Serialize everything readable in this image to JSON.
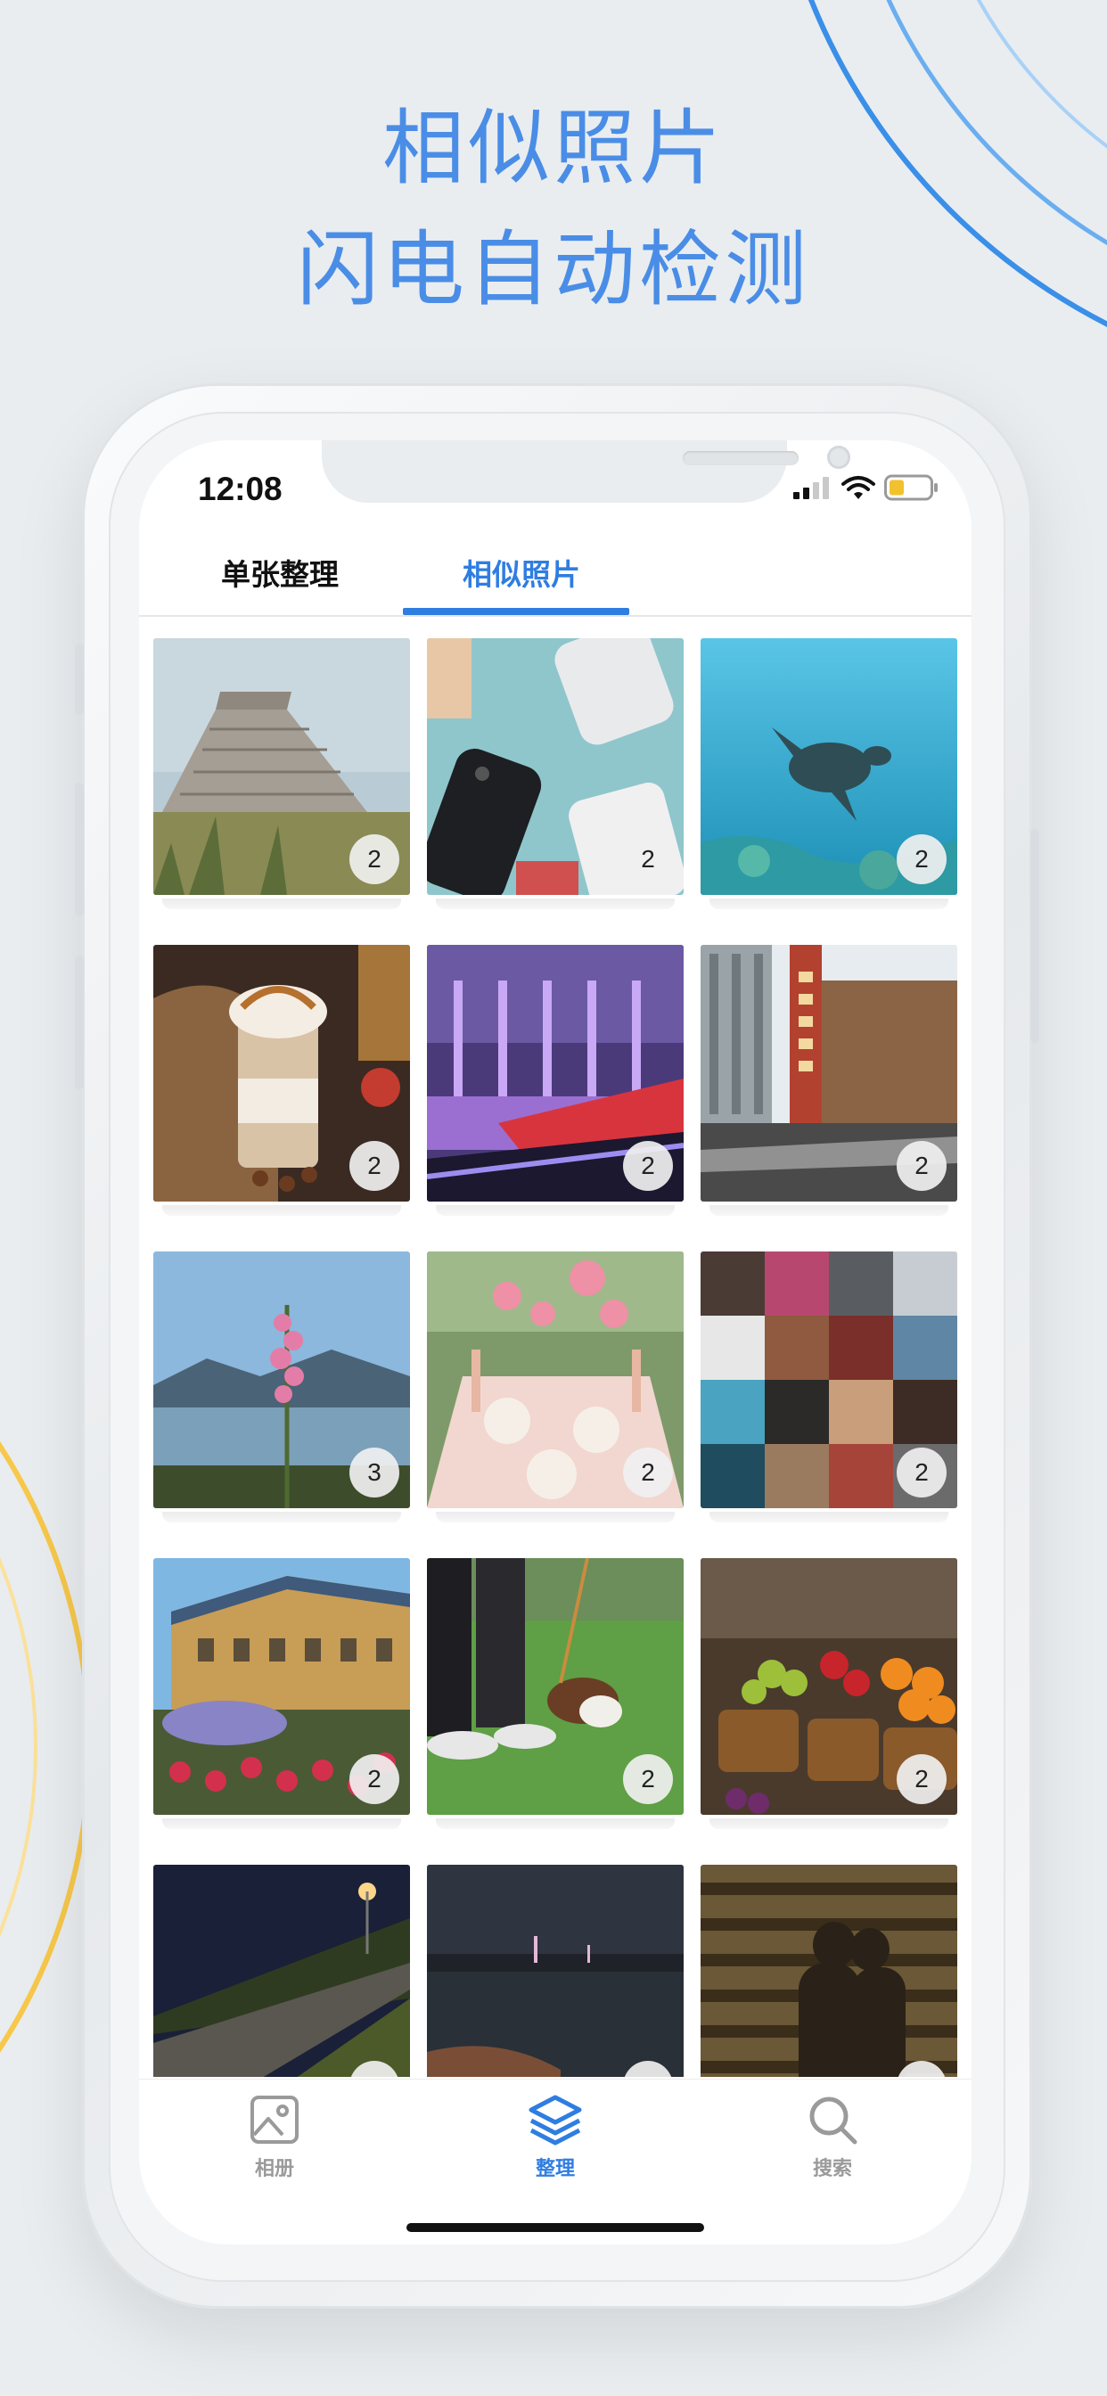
{
  "promo": {
    "headline_line1": "相似照片",
    "headline_line2": "闪电自动检测"
  },
  "status_bar": {
    "time": "12:08"
  },
  "tabs": [
    {
      "label": "单张整理",
      "active": false
    },
    {
      "label": "相似照片",
      "active": true
    }
  ],
  "photo_groups": [
    {
      "badge": "2",
      "icon": "pyramid-photo"
    },
    {
      "badge": "2",
      "icon": "phones-photo"
    },
    {
      "badge": "2",
      "icon": "turtle-photo"
    },
    {
      "badge": "2",
      "icon": "coffee-photo"
    },
    {
      "badge": "2",
      "icon": "mall-photo"
    },
    {
      "badge": "2",
      "icon": "chicago-photo"
    },
    {
      "badge": "3",
      "icon": "flower-lake-photo"
    },
    {
      "badge": "2",
      "icon": "table-flowers-photo"
    },
    {
      "badge": "2",
      "icon": "collage-photo"
    },
    {
      "badge": "2",
      "icon": "palace-photo"
    },
    {
      "badge": "2",
      "icon": "dog-grass-photo"
    },
    {
      "badge": "2",
      "icon": "fruit-market-photo"
    },
    {
      "badge": "",
      "icon": "night-road-photo"
    },
    {
      "badge": "",
      "icon": "river-night-photo"
    },
    {
      "badge": "",
      "icon": "stairs-shadow-photo"
    }
  ],
  "bottom_nav": [
    {
      "label": "相册",
      "icon": "image-icon",
      "active": false
    },
    {
      "label": "整理",
      "icon": "layers-icon",
      "active": true
    },
    {
      "label": "搜索",
      "icon": "search-icon",
      "active": false
    }
  ],
  "colors": {
    "accent": "#2f7de1",
    "headline": "#4a8de6",
    "background": "#e9edf0"
  }
}
